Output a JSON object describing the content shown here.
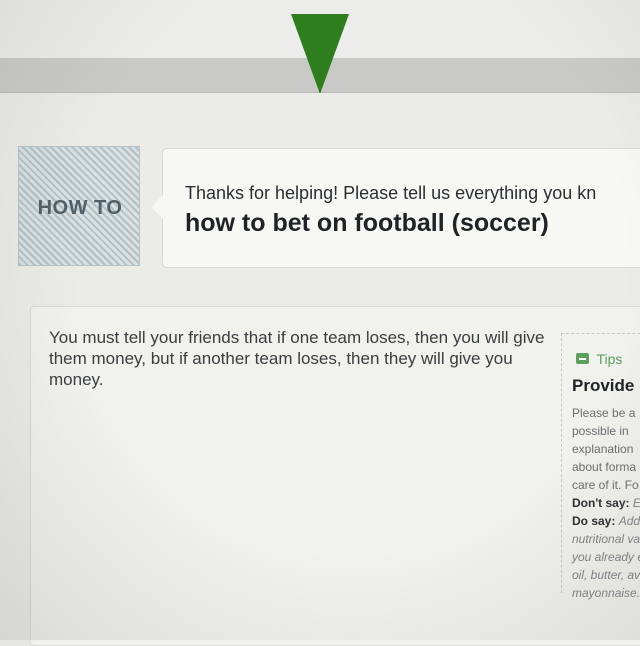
{
  "header": {
    "marker_color": "#2e7d1f"
  },
  "badge": {
    "label": "HOW TO"
  },
  "question": {
    "intro": "Thanks for helping! Please tell us everything you kn",
    "title": "how to bet on football (soccer)"
  },
  "answer": {
    "text": "You must tell your friends that if one team loses, then you will give them money, but if another team loses, then they will give you money."
  },
  "tips": {
    "icon": "minus-icon",
    "label": "Tips",
    "heading": "Provide",
    "lines": [
      "Please be a",
      "possible in",
      "explanation",
      "about forma",
      "care of it. Fo"
    ],
    "dont_say_label": "Don't say:",
    "dont_say_text": "E",
    "do_say_label": "Do say:",
    "do_say_text": "Add",
    "example_lines": [
      "nutritional va",
      "you already e",
      "oil, butter, avo",
      "mayonnaise."
    ]
  },
  "colors": {
    "accent_green": "#2e7d1f",
    "tips_green": "#5aa05a"
  }
}
